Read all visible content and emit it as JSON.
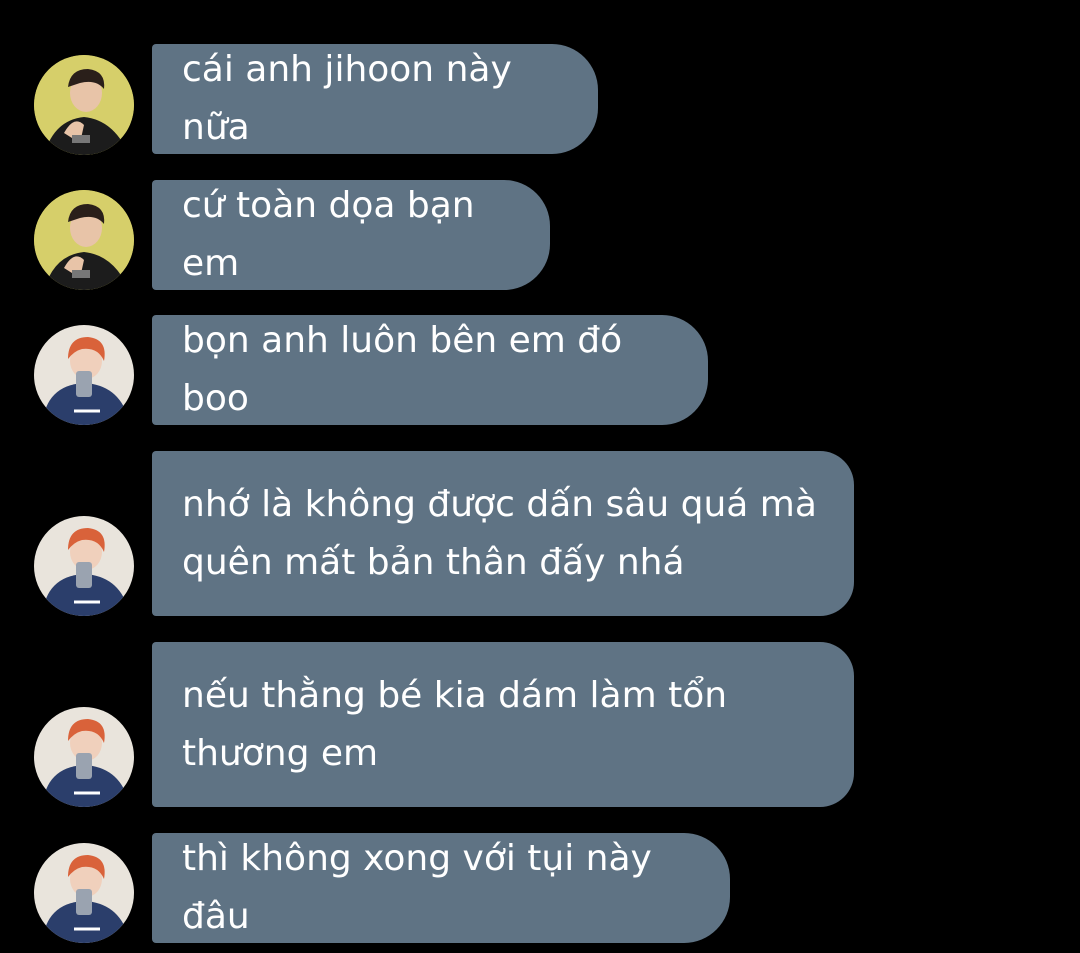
{
  "messages": [
    {
      "sender": "jihoon",
      "text": "cái anh jihoon này nữa"
    },
    {
      "sender": "jihoon",
      "text": "cứ toàn dọa bạn em"
    },
    {
      "sender": "redhair",
      "text": "bọn anh luôn bên em đó boo"
    },
    {
      "sender": "redhair",
      "text": "nhớ là không được dấn sâu quá mà\nquên mất bản thân đấy nhá"
    },
    {
      "sender": "redhair",
      "text": "nếu thằng bé kia dám làm tổn\nthương em"
    },
    {
      "sender": "redhair",
      "text": "thì không xong với tụi này đâu"
    }
  ],
  "colors": {
    "background": "#000000",
    "bubble": "#5f7384",
    "text": "#ffffff"
  }
}
